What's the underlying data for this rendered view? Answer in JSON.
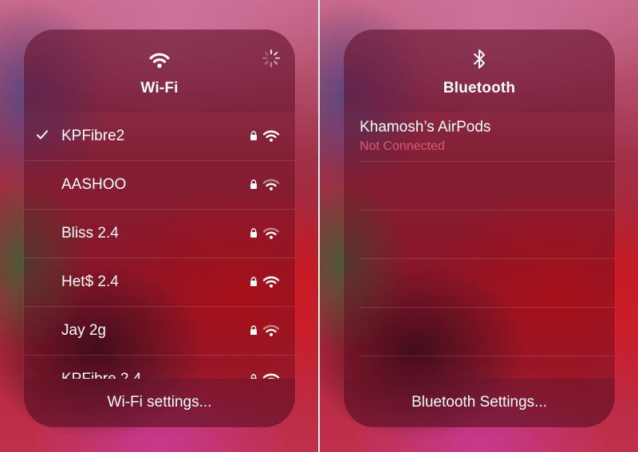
{
  "wifi_panel": {
    "title": "Wi-Fi",
    "icon": "wifi-icon",
    "networks": [
      {
        "name": "KPFibre2",
        "selected": true,
        "locked": true,
        "signal": "full"
      },
      {
        "name": "AASHOO",
        "selected": false,
        "locked": true,
        "signal": "weak"
      },
      {
        "name": "Bliss 2.4",
        "selected": false,
        "locked": true,
        "signal": "weak"
      },
      {
        "name": "Het$ 2.4",
        "selected": false,
        "locked": true,
        "signal": "full"
      },
      {
        "name": "Jay 2g",
        "selected": false,
        "locked": true,
        "signal": "weak"
      },
      {
        "name": "KPFibre 2.4",
        "selected": false,
        "locked": true,
        "signal": "full"
      }
    ],
    "footer": "Wi-Fi settings..."
  },
  "bluetooth_panel": {
    "title": "Bluetooth",
    "icon": "bluetooth-icon",
    "devices": [
      {
        "name": "Khamosh’s AirPods",
        "status": "Not Connected"
      }
    ],
    "footer": "Bluetooth Settings..."
  },
  "colors": {
    "text": "#ffffff",
    "status_not_connected": "#d95a76"
  }
}
